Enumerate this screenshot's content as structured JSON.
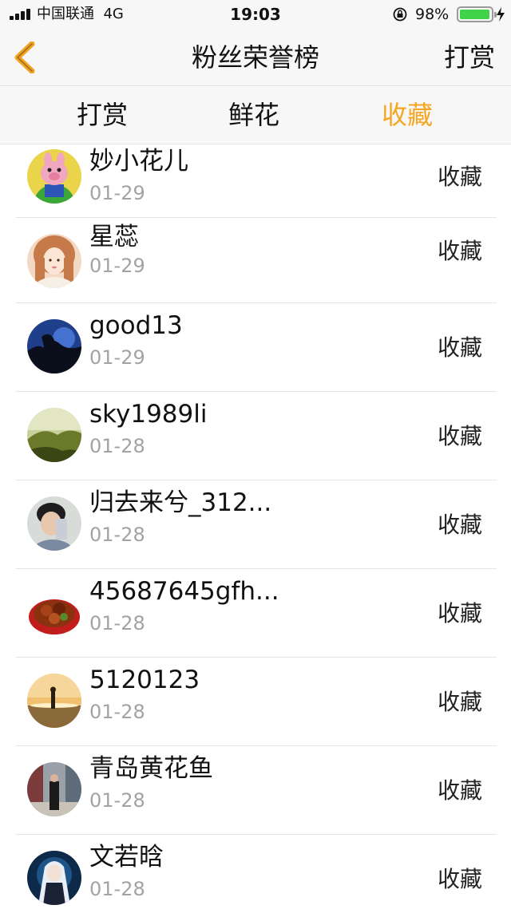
{
  "status_bar": {
    "carrier": "中国联通",
    "network": "4G",
    "time": "19:03",
    "battery_percent": "98%",
    "battery_level": 0.98,
    "battery_color": "#3fd34a"
  },
  "nav": {
    "title": "粉丝荣誉榜",
    "right_label": "打赏",
    "back_icon": "chevron-left-icon",
    "accent_color": "#f5a623"
  },
  "tabs": [
    {
      "label": "打赏",
      "active": false
    },
    {
      "label": "鲜花",
      "active": false
    },
    {
      "label": "收藏",
      "active": true
    }
  ],
  "list": [
    {
      "name": "妙小花儿",
      "date": "01-29",
      "action": "收藏",
      "avatar": "pig-cartoon-avatar"
    },
    {
      "name": "星蕊",
      "date": "01-29",
      "action": "收藏",
      "avatar": "girl-portrait-avatar"
    },
    {
      "name": "good13",
      "date": "01-29",
      "action": "收藏",
      "avatar": "dark-silhouette-avatar"
    },
    {
      "name": "sky1989li",
      "date": "01-28",
      "action": "收藏",
      "avatar": "landscape-avatar"
    },
    {
      "name": "归去来兮_312...",
      "date": "01-28",
      "action": "收藏",
      "avatar": "boy-selfie-avatar"
    },
    {
      "name": "45687645gfh...",
      "date": "01-28",
      "action": "收藏",
      "avatar": "food-dish-avatar"
    },
    {
      "name": "5120123",
      "date": "01-28",
      "action": "收藏",
      "avatar": "sunset-beach-avatar"
    },
    {
      "name": "青岛黄花鱼",
      "date": "01-28",
      "action": "收藏",
      "avatar": "street-photo-avatar"
    },
    {
      "name": "文若晗",
      "date": "01-28",
      "action": "收藏",
      "avatar": "anime-character-avatar"
    }
  ]
}
